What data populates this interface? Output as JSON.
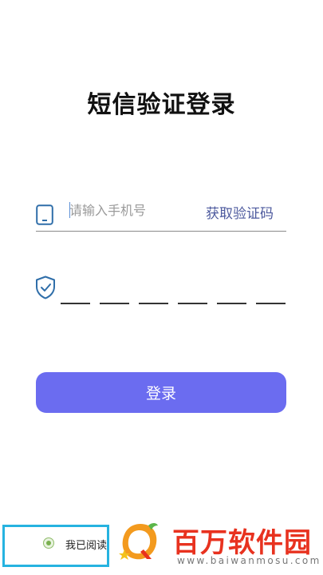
{
  "title": "短信验证登录",
  "phone_input": {
    "placeholder": "请输入手机号",
    "value": ""
  },
  "get_code_label": "获取验证码",
  "code_slots": [
    "",
    "",
    "",
    "",
    "",
    ""
  ],
  "login_label": "登录",
  "agreement_text": "我已阅读",
  "watermark": {
    "brand": "百万软件园",
    "url": "www.baiwanmosu.com"
  },
  "colors": {
    "accent": "#6b6cf0",
    "link": "#4d5a9e",
    "icon": "#2f6ea9",
    "watermark_red": "#e8321f"
  },
  "icons": {
    "phone": "phone-icon",
    "shield": "shield-check-icon"
  }
}
